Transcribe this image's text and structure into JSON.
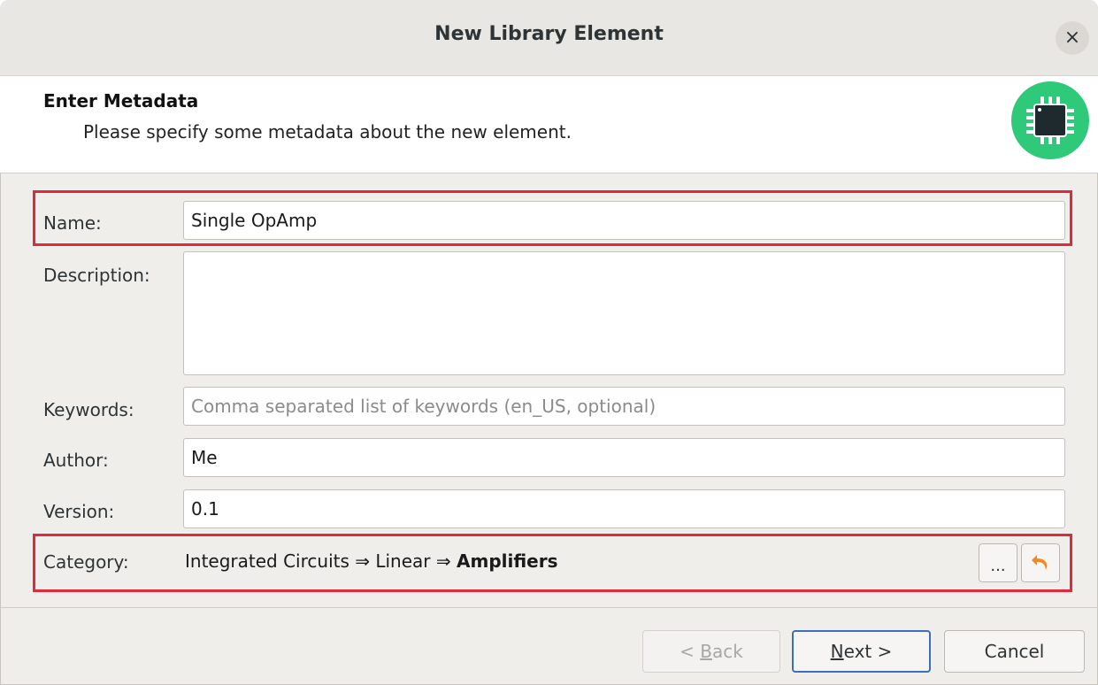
{
  "window": {
    "title": "New Library Element",
    "close_glyph": "×"
  },
  "header": {
    "title": "Enter Metadata",
    "subtitle": "Please specify some metadata about the new element.",
    "icon": "chip-icon",
    "icon_color": "#2fc97a"
  },
  "form": {
    "name_label": "Name:",
    "name_value": "Single OpAmp",
    "description_label": "Description:",
    "description_value": "",
    "keywords_label": "Keywords:",
    "keywords_placeholder": "Comma separated list of keywords (en_US, optional)",
    "author_label": "Author:",
    "author_value": "Me",
    "version_label": "Version:",
    "version_value": "0.1",
    "category_label": "Category:",
    "category_path_prefix": "Integrated Circuits ⇒ Linear ⇒ ",
    "category_path_last": "Amplifiers",
    "choose_button_label": "...",
    "reset_icon": "undo-arrow-icon"
  },
  "buttons": {
    "back_prefix": "< ",
    "back_mnemonic": "B",
    "back_suffix": "ack",
    "next_mnemonic": "N",
    "next_suffix": "ext >",
    "cancel_label": "Cancel"
  },
  "colors": {
    "highlight": "#e02a3b",
    "accent": "#3b6fb8",
    "reset_icon": "#f08a24"
  }
}
